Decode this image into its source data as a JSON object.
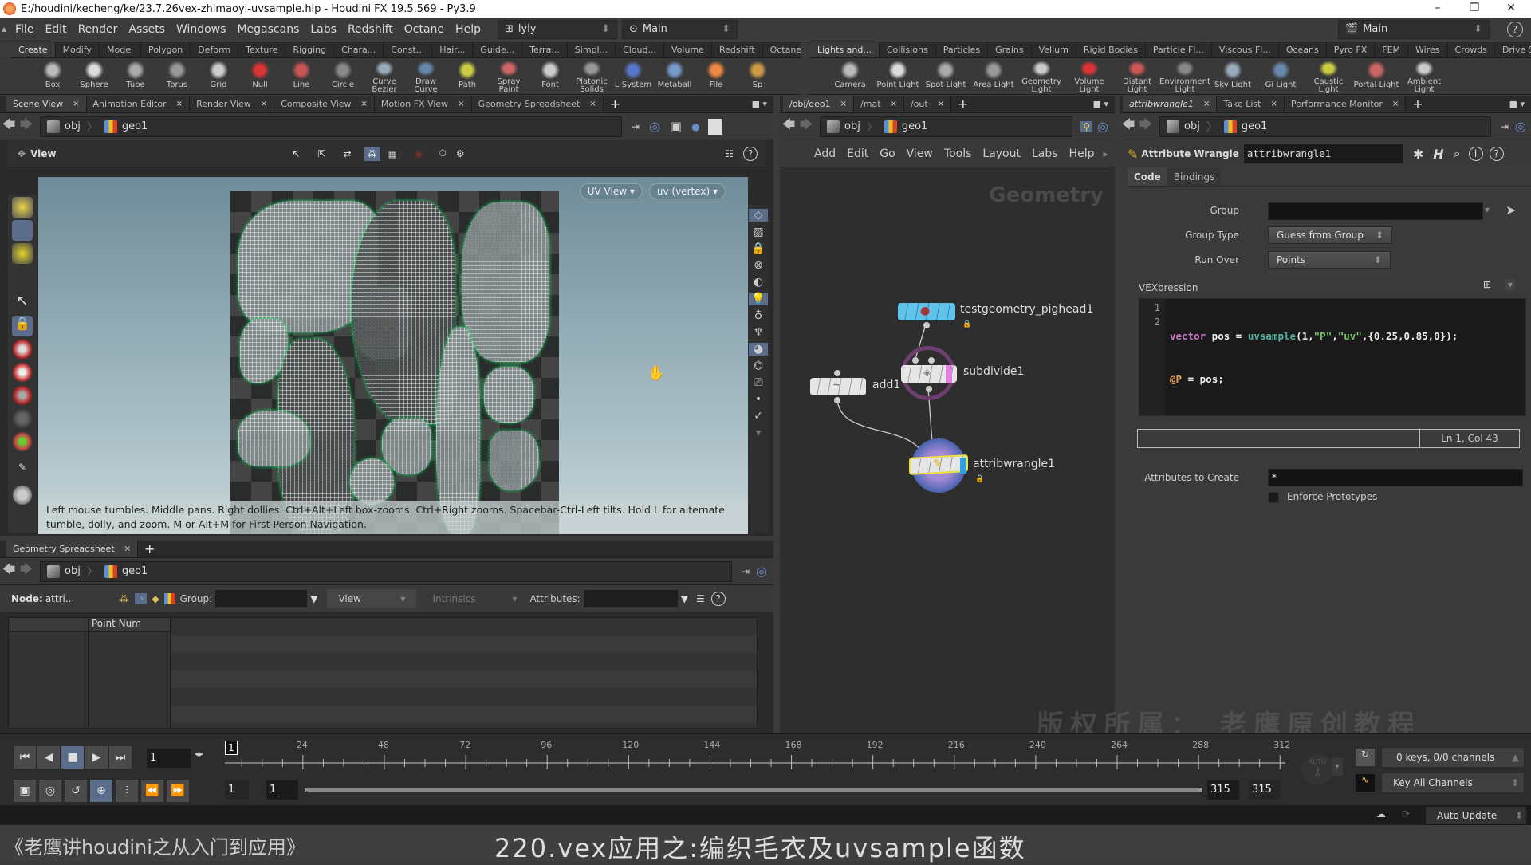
{
  "window": {
    "title": "E:/houdini/kecheng/ke/23.7.26vex-zhimaoyi-uvsample.hip - Houdini FX 19.5.569 - Py3.9",
    "controls": [
      "–",
      "❐",
      "✕"
    ]
  },
  "menubar": {
    "items": [
      "File",
      "Edit",
      "Render",
      "Assets",
      "Windows",
      "Megascans",
      "Labs",
      "Redshift",
      "Octane",
      "Help"
    ],
    "desktop": "lyly",
    "main_layout": "Main",
    "right_main": "Main",
    "help": "?"
  },
  "shelf_left": {
    "tabs": [
      "Create",
      "Modify",
      "Model",
      "Polygon",
      "Deform",
      "Texture",
      "Rigging",
      "Chara...",
      "Const...",
      "Hair...",
      "Guide...",
      "Terra...",
      "Simpl...",
      "Cloud...",
      "Volume",
      "Redshift",
      "Octane"
    ],
    "tools": [
      "Box",
      "Sphere",
      "Tube",
      "Torus",
      "Grid",
      "Null",
      "Line",
      "Circle",
      "Curve Bezier",
      "Draw Curve",
      "Path",
      "Spray Paint",
      "Font",
      "Platonic Solids",
      "L-System",
      "Metaball",
      "File",
      "Sp"
    ]
  },
  "shelf_right": {
    "tabs": [
      "Lights and...",
      "Collisions",
      "Particles",
      "Grains",
      "Vellum",
      "Rigid Bodies",
      "Particle Fl...",
      "Viscous Fl...",
      "Oceans",
      "Pyro FX",
      "FEM",
      "Wires",
      "Crowds",
      "Drive Sim..."
    ],
    "tools": [
      "Camera",
      "Point Light",
      "Spot Light",
      "Area Light",
      "Geometry Light",
      "Volume Light",
      "Distant Light",
      "Environment Light",
      "Sky Light",
      "GI Light",
      "Caustic Light",
      "Portal Light",
      "Ambient Light"
    ]
  },
  "scene_pane": {
    "tabs": [
      "Scene View",
      "Animation Editor",
      "Render View",
      "Composite View",
      "Motion FX View",
      "Geometry Spreadsheet"
    ],
    "path": [
      "obj",
      "geo1"
    ],
    "view_label": "View",
    "uv_view_btn": "UV View",
    "uv_attr_btn": "uv (vertex)",
    "hint": "Left mouse tumbles. Middle pans. Right dollies. Ctrl+Alt+Left box-zooms. Ctrl+Right zooms. Spacebar-Ctrl-Left tilts. Hold L for alternate tumble, dolly, and zoom.    M or Alt+M for First Person Navigation."
  },
  "spreadsheet": {
    "tab": "Geometry Spreadsheet",
    "path": [
      "obj",
      "geo1"
    ],
    "node_label": "Node:",
    "node_value": "attri...",
    "group_label": "Group:",
    "view_menu": "View",
    "intrinsics_menu": "Intrinsics",
    "attributes_label": "Attributes:",
    "columns": [
      "",
      "Point Num"
    ]
  },
  "network": {
    "tabs": [
      "/obj/geo1",
      "/mat",
      "/out"
    ],
    "path": [
      "obj",
      "geo1"
    ],
    "menu": [
      "Add",
      "Edit",
      "Go",
      "View",
      "Tools",
      "Layout",
      "Labs",
      "Help"
    ],
    "context_label": "Geometry",
    "nodes": [
      {
        "name": "testgeometry_pighead1",
        "color": "#5fc3ea"
      },
      {
        "name": "subdivide1",
        "color": "#e8e8e8"
      },
      {
        "name": "add1",
        "color": "#e8e8e8"
      },
      {
        "name": "attribwrangle1",
        "color": "#e8e8e8"
      }
    ]
  },
  "params": {
    "tabs": [
      "attribwrangle1",
      "Take List",
      "Performance Monitor"
    ],
    "path": [
      "obj",
      "geo1"
    ],
    "node_type": "Attribute Wrangle",
    "node_name": "attribwrangle1",
    "subtabs": [
      "Code",
      "Bindings"
    ],
    "group_label": "Group",
    "group_value": "",
    "group_type_label": "Group Type",
    "group_type_value": "Guess from Group",
    "run_over_label": "Run Over",
    "run_over_value": "Points",
    "vex_label": "VEXpression",
    "code_lines": [
      "1",
      "2"
    ],
    "code": {
      "l1_kw": "vector",
      "l1_var": " pos = ",
      "l1_fn": "uvsample",
      "l1_a": "(1,",
      "l1_s1": "\"P\"",
      "l1_c": ",",
      "l1_s2": "\"uv\"",
      "l1_b": ",{0.25,0.85,0});",
      "l2_at": "@P",
      "l2_rest": " = pos;"
    },
    "cursor_pos": "Ln 1, Col 43",
    "attrs_create_label": "Attributes to Create",
    "attrs_create_value": "*",
    "enforce_label": "Enforce Prototypes",
    "enforce_checked": false
  },
  "timeline": {
    "current_frame": "1",
    "frame_marker": "1",
    "ticks": [
      "24",
      "48",
      "72",
      "96",
      "120",
      "144",
      "168",
      "192",
      "216",
      "240",
      "264",
      "288",
      "312"
    ],
    "range_start": "1",
    "range_start2": "1",
    "range_end": "315",
    "range_end2": "315",
    "keys_info": "0 keys, 0/0 channels",
    "key_mode": "Key All Channels",
    "auto_label": "AUTO",
    "update_mode": "Auto Update"
  },
  "overlay": {
    "watermark": "版权所属： 老鹰原创教程",
    "course_title": "《老鹰讲houdini之从入门到应用》",
    "lesson_title": "220.vex应用之:编织毛衣及uvsample函数"
  }
}
